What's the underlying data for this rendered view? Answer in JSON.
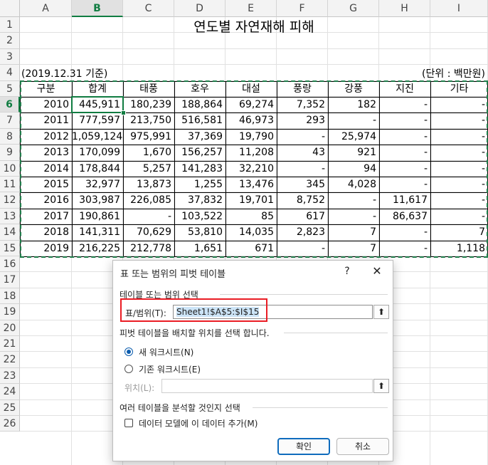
{
  "columns": [
    "A",
    "B",
    "C",
    "D",
    "E",
    "F",
    "G",
    "H",
    "I"
  ],
  "rows": [
    "1",
    "2",
    "3",
    "4",
    "5",
    "6",
    "7",
    "8",
    "9",
    "10",
    "11",
    "12",
    "13",
    "14",
    "15",
    "16",
    "17",
    "18",
    "19",
    "20",
    "21",
    "22",
    "23",
    "24",
    "25",
    "26"
  ],
  "title": "연도별 자연재해 피해",
  "date_note": "(2019.12.31 기준)",
  "unit_note": "(단위 : 백만원)",
  "table_headers": [
    "구분",
    "합계",
    "태풍",
    "호우",
    "대설",
    "풍랑",
    "강풍",
    "지진",
    "기타"
  ],
  "table_rows": [
    [
      "2010",
      "445,911",
      "180,239",
      "188,864",
      "69,274",
      "7,352",
      "182",
      "-",
      "-"
    ],
    [
      "2011",
      "777,597",
      "213,750",
      "516,581",
      "46,973",
      "293",
      "-",
      "-",
      "-"
    ],
    [
      "2012",
      "1,059,124",
      "975,991",
      "37,369",
      "19,790",
      "-",
      "25,974",
      "-",
      "-"
    ],
    [
      "2013",
      "170,099",
      "1,670",
      "156,257",
      "11,208",
      "43",
      "921",
      "-",
      "-"
    ],
    [
      "2014",
      "178,844",
      "5,257",
      "141,283",
      "32,210",
      "-",
      "94",
      "-",
      "-"
    ],
    [
      "2015",
      "32,977",
      "13,873",
      "1,255",
      "13,476",
      "345",
      "4,028",
      "-",
      "-"
    ],
    [
      "2016",
      "303,987",
      "226,085",
      "37,832",
      "19,701",
      "8,752",
      "-",
      "11,617",
      "-"
    ],
    [
      "2017",
      "190,861",
      "-",
      "103,522",
      "85",
      "617",
      "-",
      "86,637",
      "-"
    ],
    [
      "2018",
      "141,311",
      "70,629",
      "53,810",
      "14,035",
      "2,823",
      "7",
      "-",
      "7"
    ],
    [
      "2019",
      "216,225",
      "212,778",
      "1,651",
      "671",
      "-",
      "7",
      "-",
      "1,118"
    ]
  ],
  "dialog": {
    "title": "표 또는 범위의 피벗 테이블",
    "help": "?",
    "close": "✕",
    "section1": "테이블 또는 범위 선택",
    "range_label": "표/범위(T):",
    "range_value": "Sheet1!$A$5:$I$15",
    "section2": "피벗 테이블을 배치할 위치를 선택 합니다.",
    "radio_new": "새 워크시트(N)",
    "radio_existing": "기존 워크시트(E)",
    "location_label": "위치(L):",
    "location_value": "",
    "section3": "여러 테이블을 분석할 것인지 선택",
    "checkbox_label": "데이터 모델에 이 데이터 추가(M)",
    "ok": "확인",
    "cancel": "취소"
  },
  "colors": {
    "accent_green": "#107c41",
    "highlight_red": "#ea1c24",
    "primary_blue": "#0f6cbd"
  }
}
